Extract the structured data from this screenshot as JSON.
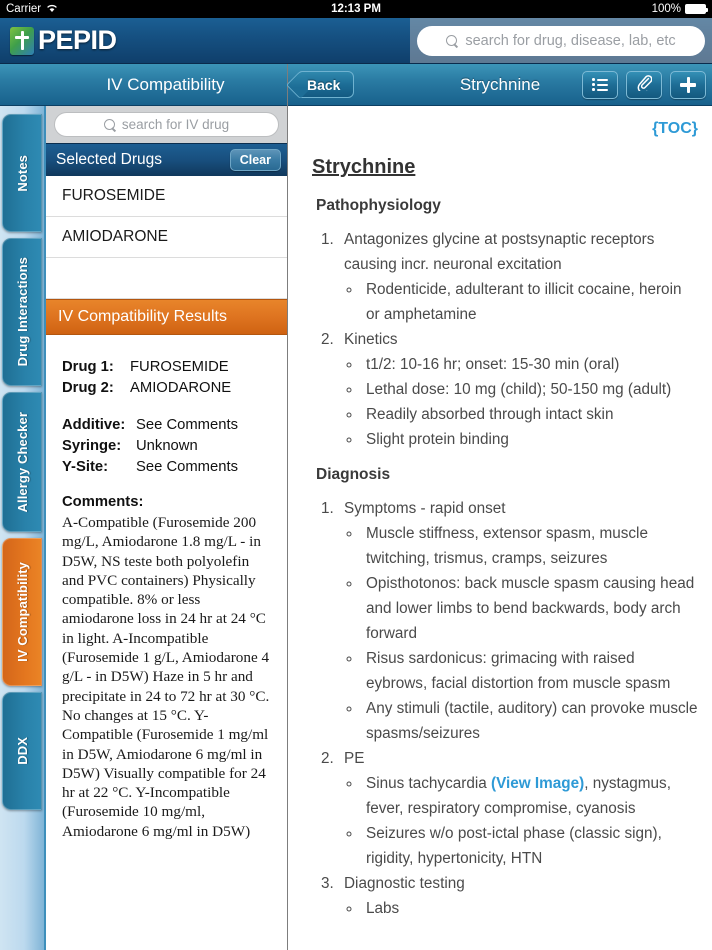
{
  "status_bar": {
    "carrier": "Carrier",
    "wifi_icon": "wifi-icon",
    "time": "12:13 PM",
    "battery_percent": "100%"
  },
  "app_header": {
    "brand": "PEPID",
    "logo_icon": "pepid-caduceus-logo",
    "global_search": {
      "placeholder": "search for drug, disease, lab, etc",
      "value": "",
      "icon": "search-icon"
    }
  },
  "left_panel": {
    "title": "IV Compatibility",
    "rail_tabs": [
      {
        "label": "Notes",
        "active": false
      },
      {
        "label": "Drug Interactions",
        "active": false
      },
      {
        "label": "Allergy Checker",
        "active": false
      },
      {
        "label": "IV Compatibility",
        "active": true
      },
      {
        "label": "DDX",
        "active": false
      }
    ],
    "drug_search": {
      "placeholder": "search for IV drug",
      "value": "",
      "icon": "search-icon"
    },
    "selected_drugs_header": "Selected Drugs",
    "clear_label": "Clear",
    "selected_drugs": [
      "FUROSEMIDE",
      "AMIODARONE"
    ],
    "results_header": "IV Compatibility Results",
    "results": {
      "drug1_label": "Drug 1:",
      "drug1_value": "FUROSEMIDE",
      "drug2_label": "Drug 2:",
      "drug2_value": "AMIODARONE",
      "additive_label": "Additive:",
      "additive_value": "See Comments",
      "syringe_label": "Syringe:",
      "syringe_value": "Unknown",
      "ysite_label": "Y-Site:",
      "ysite_value": "See Comments",
      "comments_label": "Comments:",
      "comments_text": "A-Compatible (Furosemide 200 mg/L, Amiodarone 1.8 mg/L - in D5W, NS teste both polyolefin and PVC containers) Physically compatible. 8% or less amiodarone loss in 24 hr at 24 °C in light. A-Incompatible (Furosemide 1 g/L, Amiodarone 4 g/L - in D5W) Haze in 5 hr and precipitate in 24 to 72 hr at 30 °C. No changes at 15 °C. Y-Compatible (Furosemide 1 mg/ml in D5W, Amiodarone 6 mg/ml in D5W) Visually compatible for 24 hr at 22 °C. Y-Incompatible (Furosemide 10 mg/ml, Amiodarone 6 mg/ml in D5W)"
    }
  },
  "right_panel": {
    "back_label": "Back",
    "nav_title": "Strychnine",
    "actions": [
      {
        "name": "toc-list-button",
        "icon": "list-icon"
      },
      {
        "name": "attachments-button",
        "icon": "paperclip-icon"
      },
      {
        "name": "add-button",
        "icon": "plus-icon"
      }
    ],
    "toc_link": "{TOC}",
    "doc_title": "Strychnine",
    "sections": [
      {
        "heading": "Pathophysiology",
        "items": [
          {
            "text": "Antagonizes glycine at postsynaptic receptors causing incr. neuronal excitation",
            "sub": [
              "Rodenticide, adulterant to illicit cocaine, heroin or amphetamine"
            ]
          },
          {
            "text": "Kinetics",
            "sub": [
              "t1/2: 10-16 hr; onset: 15-30 min (oral)",
              "Lethal dose: 10 mg (child); 50-150 mg (adult)",
              "Readily absorbed through intact skin",
              "Slight protein binding"
            ]
          }
        ]
      },
      {
        "heading": "Diagnosis",
        "items": [
          {
            "text": "Symptoms - rapid onset",
            "sub": [
              "Muscle stiffness, extensor spasm, muscle twitching, trismus, cramps, seizures",
              "Opisthotonos: back muscle spasm causing head and lower limbs to bend backwards, body arch forward",
              "Risus sardonicus: grimacing with raised eybrows, facial distortion from muscle spasm",
              "Any stimuli (tactile, auditory) can provoke muscle spasms/seizures"
            ]
          },
          {
            "text": "PE",
            "sub_rich": [
              {
                "pre": "Sinus tachycardia ",
                "link": "(View Image)",
                "post": ", nystagmus, fever, respiratory compromise, cyanosis"
              },
              {
                "pre": "Seizures w/o post-ictal phase (classic sign), rigidity, hypertonicity, HTN",
                "link": "",
                "post": ""
              }
            ]
          },
          {
            "text": "Diagnostic testing",
            "sub": [
              "Labs"
            ]
          }
        ]
      }
    ]
  },
  "colors": {
    "brand_blue": "#15507f",
    "header_teal": "#2a7ba3",
    "accent_orange": "#de7420",
    "link_blue": "#2e9ad6",
    "selected_navy": "#184f7e"
  }
}
